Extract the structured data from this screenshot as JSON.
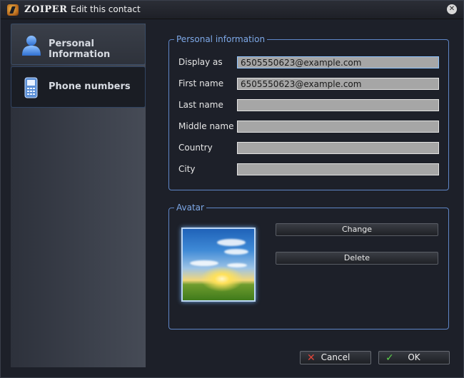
{
  "window": {
    "app_name": "ZOIPER",
    "title": "Edit this contact",
    "close_icon": "close-icon"
  },
  "sidebar": {
    "items": [
      {
        "label": "Personal Information",
        "icon": "person-icon",
        "active": true
      },
      {
        "label": "Phone numbers",
        "icon": "phone-icon",
        "active": false
      }
    ]
  },
  "personal_info": {
    "title": "Personal information",
    "fields": [
      {
        "label": "Display as",
        "value": "6505550623@example.com"
      },
      {
        "label": "First name",
        "value": "6505550623@example.com"
      },
      {
        "label": "Last name",
        "value": ""
      },
      {
        "label": "Middle name",
        "value": ""
      },
      {
        "label": "Country",
        "value": ""
      },
      {
        "label": "City",
        "value": ""
      }
    ]
  },
  "avatar": {
    "title": "Avatar",
    "change_label": "Change",
    "delete_label": "Delete"
  },
  "footer": {
    "cancel_label": "Cancel",
    "ok_label": "OK"
  },
  "colors": {
    "accent": "#7ea9e8",
    "group_border": "#5f86c7",
    "cancel_icon": "#e0453a",
    "ok_icon": "#5bd04a"
  }
}
